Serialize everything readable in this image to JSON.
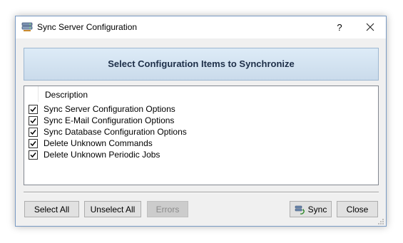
{
  "window": {
    "title": "Sync Server Configuration",
    "help_glyph": "?",
    "app_icon": "server-sync-icon"
  },
  "banner": {
    "heading": "Select Configuration Items to Synchronize"
  },
  "list": {
    "column_header": "Description",
    "items": [
      {
        "label": "Sync Server Configuration Options",
        "checked": true
      },
      {
        "label": "Sync E-Mail Configuration Options",
        "checked": true
      },
      {
        "label": "Sync Database Configuration Options",
        "checked": true
      },
      {
        "label": "Delete Unknown Commands",
        "checked": true
      },
      {
        "label": "Delete Unknown Periodic Jobs",
        "checked": true
      }
    ]
  },
  "buttons": {
    "select_all": "Select All",
    "unselect_all": "Unselect All",
    "errors": "Errors",
    "sync": "Sync",
    "close": "Close"
  },
  "colors": {
    "banner_text": "#1d2e48",
    "banner_bg": "#d4e4f2",
    "window_border": "#7a9bc4"
  }
}
